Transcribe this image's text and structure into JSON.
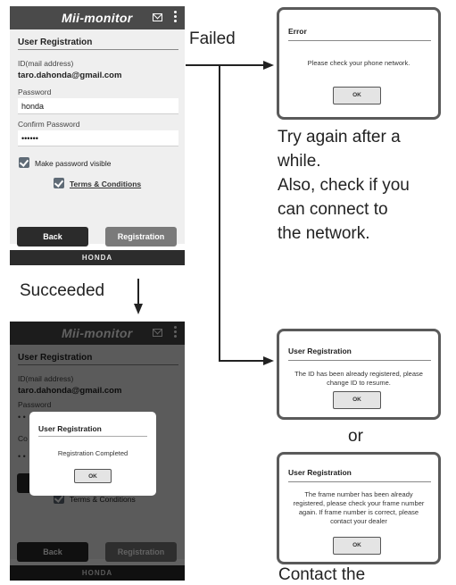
{
  "app": {
    "title": "Mii-monitor",
    "footer": "HONDA",
    "icons": [
      "mail-icon",
      "more-menu-icon"
    ]
  },
  "registration_form": {
    "heading": "User Registration",
    "id_label": "ID(mail address)",
    "id_value": "taro.dahonda@gmail.com",
    "password_label": "Password",
    "password_value": "honda",
    "confirm_label": "Confirm Password",
    "confirm_value": "••••••",
    "make_visible_label": "Make password visible",
    "make_visible_checked": true,
    "terms_label": "Terms & Conditions",
    "terms_checked": true,
    "back_button": "Back",
    "registration_button": "Registration"
  },
  "bottom_screen": {
    "confirm_masked_partial": "• •",
    "dialog": {
      "title": "User Registration",
      "message": "Registration Completed",
      "ok": "OK"
    }
  },
  "flow": {
    "failed_label": "Failed",
    "succeeded_label": "Succeeded",
    "or_label": "or",
    "error_dialog": {
      "title": "Error",
      "message": "Please check your phone network.",
      "ok": "OK"
    },
    "network_caption": [
      "Try again after a",
      "while.",
      "Also, check if you",
      "can connect to",
      "the network."
    ],
    "already_registered_dialog": {
      "title": "User Registration",
      "message_line1": "The ID has been already registered, please",
      "message_line2": "change ID to resume.",
      "ok": "OK"
    },
    "frame_dialog": {
      "title": "User Registration",
      "message_line1": "The frame number has been already",
      "message_line2": "registered, please check your frame number",
      "message_line3": "again. If frame number is correct, please",
      "message_line4": "contact your dealer",
      "ok": "OK"
    },
    "bottom_caption_partial": "Contact the"
  },
  "colors": {
    "appbar": "#4a4a4a",
    "footer": "#2c2c2c",
    "dialog_border": "#5a5a5a",
    "checkbox": "#5f6b76"
  }
}
